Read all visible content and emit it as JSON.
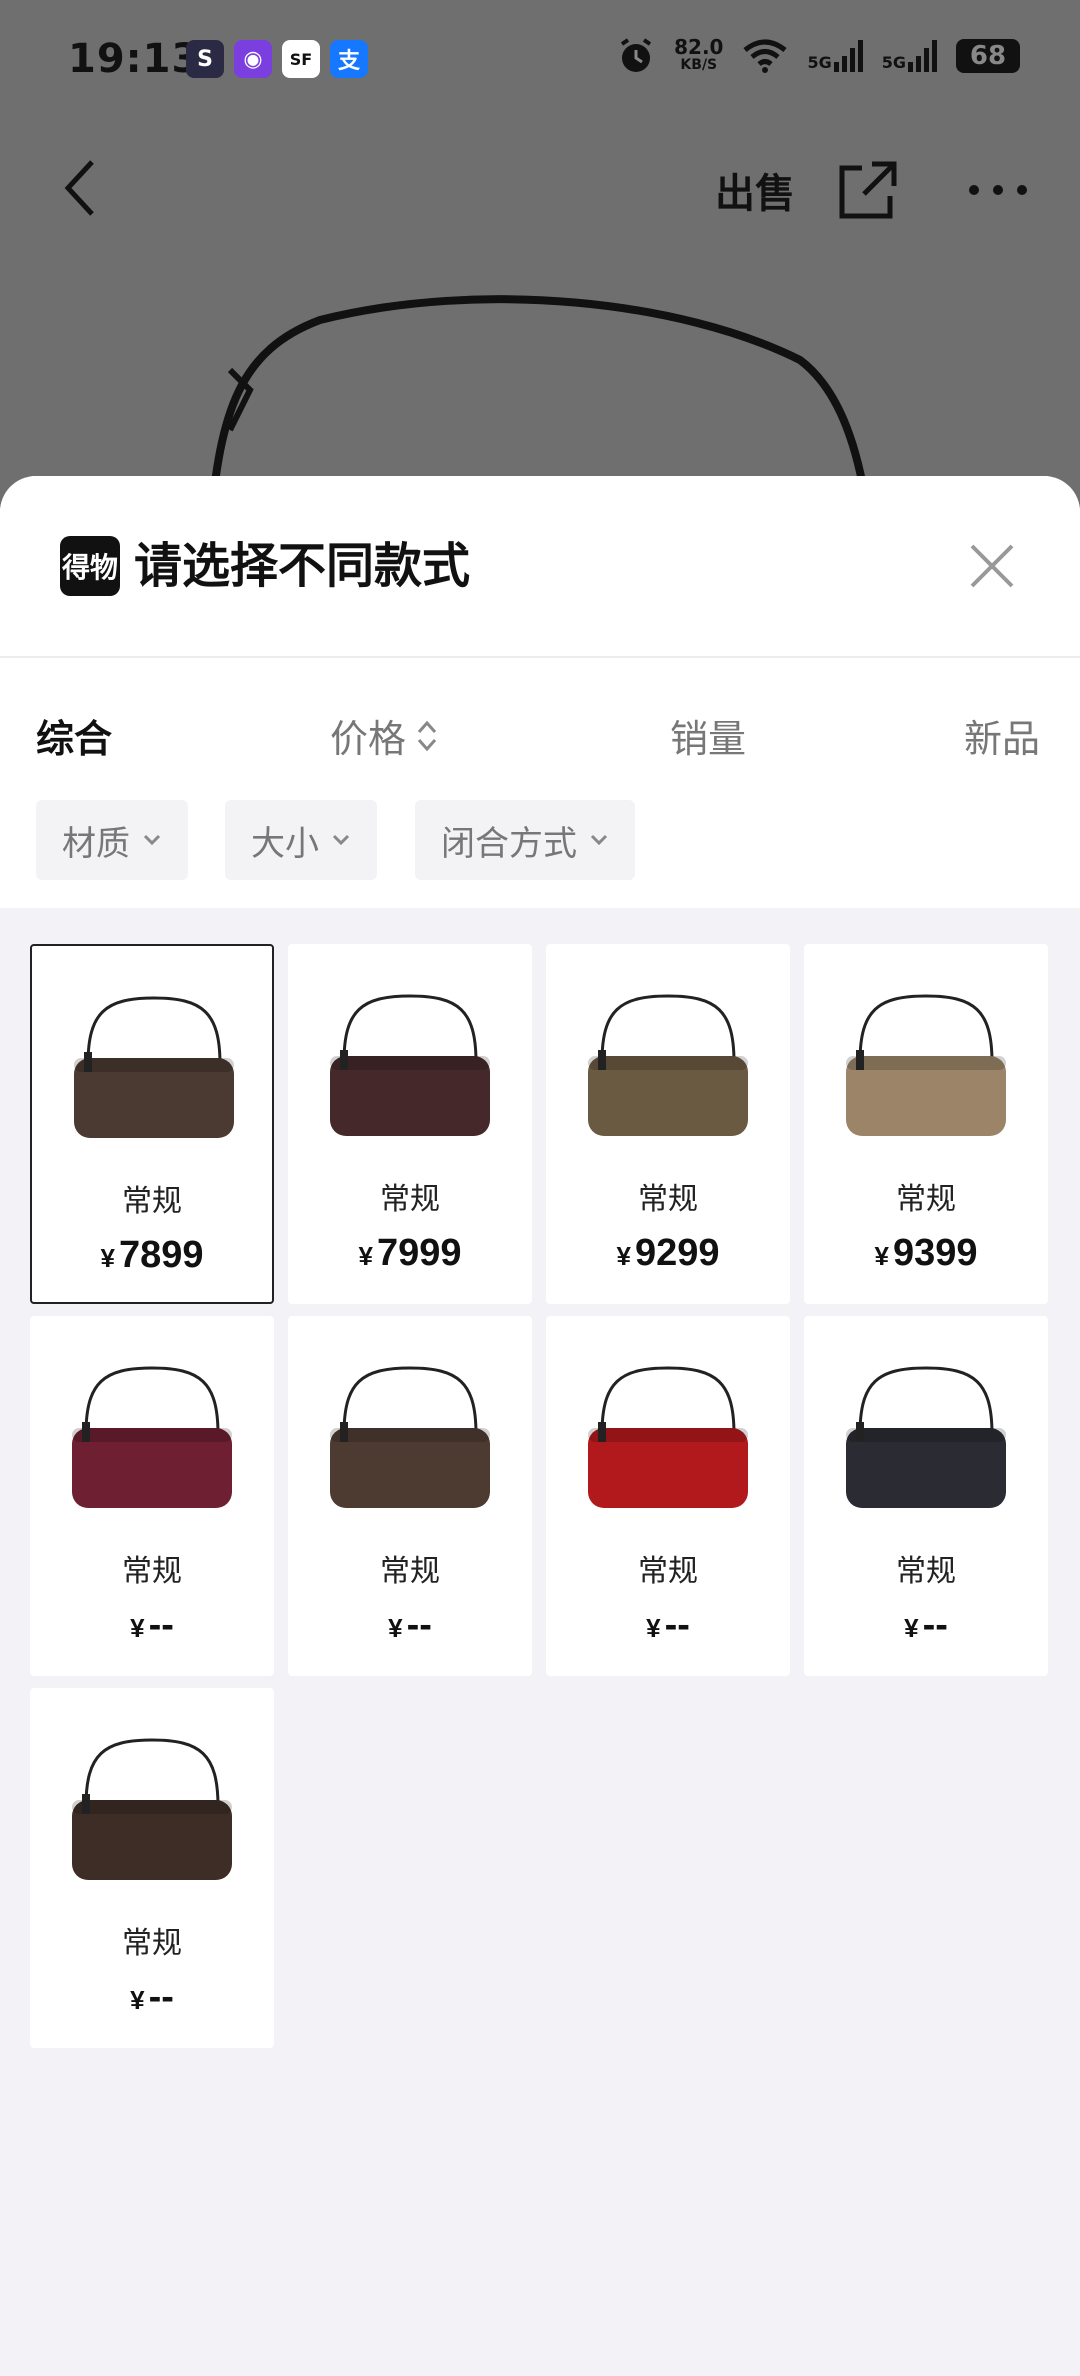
{
  "status_bar": {
    "time": "19:13",
    "net_speed": "82.0",
    "net_unit": "KB/S",
    "signal1": "5G",
    "signal2": "5G",
    "battery": "68"
  },
  "nav": {
    "sell_label": "出售"
  },
  "sheet": {
    "logo_text": "得物",
    "title": "请选择不同款式",
    "sort_tabs": [
      "综合",
      "价格",
      "销量",
      "新品"
    ],
    "filters": [
      "材质",
      "大小",
      "闭合方式"
    ],
    "currency": "¥",
    "products": [
      {
        "label": "常规",
        "price": "7899",
        "color": "#4a3a31",
        "selected": true
      },
      {
        "label": "常规",
        "price": "7999",
        "color": "#45292a"
      },
      {
        "label": "常规",
        "price": "9299",
        "color": "#6b5a42"
      },
      {
        "label": "常规",
        "price": "9399",
        "color": "#9c8468"
      },
      {
        "label": "常规",
        "price": "--",
        "color": "#6e1f31"
      },
      {
        "label": "常规",
        "price": "--",
        "color": "#4d3b32"
      },
      {
        "label": "常规",
        "price": "--",
        "color": "#b2191c"
      },
      {
        "label": "常规",
        "price": "--",
        "color": "#2b2c33"
      },
      {
        "label": "常规",
        "price": "--",
        "color": "#3d2d26"
      }
    ]
  }
}
